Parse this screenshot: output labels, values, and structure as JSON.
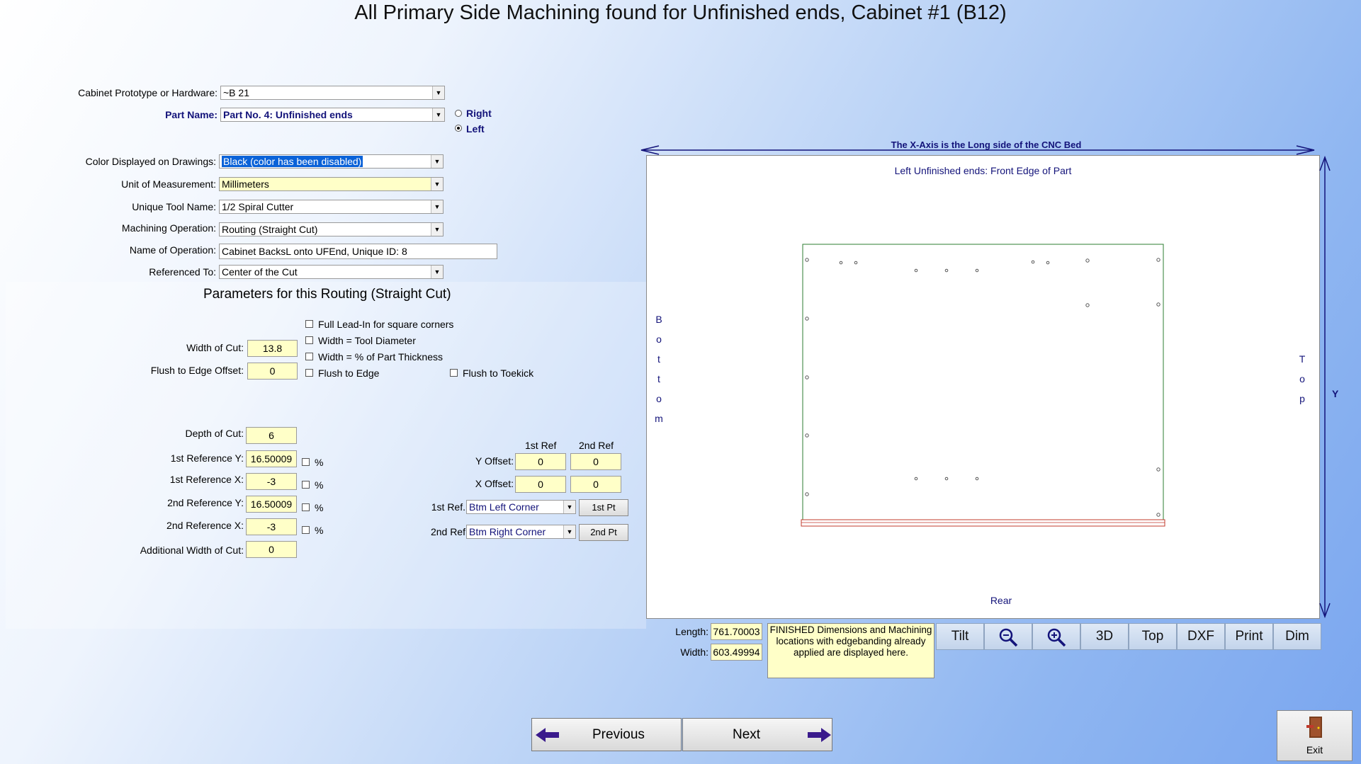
{
  "title": "All Primary Side Machining found for Unfinished ends, Cabinet #1 (B12)",
  "form": {
    "prototype": {
      "label": "Cabinet Prototype or Hardware:",
      "value": "~B 21"
    },
    "part_name": {
      "label": "Part Name:",
      "value": "Part No. 4:  Unfinished ends"
    },
    "side_right": "Right",
    "side_left": "Left",
    "color": {
      "label": "Color Displayed on Drawings:",
      "value": "Black (color has been disabled)"
    },
    "unit": {
      "label": "Unit of Measurement:",
      "value": "Millimeters"
    },
    "tool": {
      "label": "Unique Tool Name:",
      "value": "1/2 Spiral Cutter"
    },
    "operation": {
      "label": "Machining Operation:",
      "value": "Routing (Straight Cut)"
    },
    "op_name": {
      "label": "Name of Operation:",
      "value": "Cabinet BacksL onto UFEnd, Unique ID: 8"
    },
    "ref_to": {
      "label": "Referenced To:",
      "value": "Center of the Cut"
    }
  },
  "params": {
    "title": "Parameters for this Routing (Straight Cut)",
    "width_of_cut": {
      "label": "Width of Cut:",
      "value": "13.8"
    },
    "flush_offset": {
      "label": "Flush to Edge Offset:",
      "value": "0"
    },
    "chk_full_lead": "Full Lead-In for square corners",
    "chk_tool_dia": "Width = Tool Diameter",
    "chk_pct_thick": "Width = % of Part Thickness",
    "chk_flush_edge": "Flush to Edge",
    "chk_flush_toekick": "Flush to Toekick",
    "depth": {
      "label": "Depth of Cut:",
      "value": "6"
    },
    "ref1_y": {
      "label": "1st Reference Y:",
      "value": "16.50009"
    },
    "ref1_x": {
      "label": "1st Reference X:",
      "value": "-3"
    },
    "ref2_y": {
      "label": "2nd Reference Y:",
      "value": "16.50009"
    },
    "ref2_x": {
      "label": "2nd Reference X:",
      "value": "-3"
    },
    "add_width": {
      "label": "Additional Width of Cut:",
      "value": "0"
    },
    "pct": "%",
    "col_1st": "1st Ref",
    "col_2nd": "2nd Ref",
    "y_offset": {
      "label": "Y Offset:",
      "v1": "0",
      "v2": "0"
    },
    "x_offset": {
      "label": "X Offset:",
      "v1": "0",
      "v2": "0"
    },
    "ref1": {
      "label": "1st Ref.",
      "value": "Btm Left Corner",
      "button": "1st Pt"
    },
    "ref2": {
      "label": "2nd Ref",
      "value": "Btm Right Corner",
      "button": "2nd Pt"
    }
  },
  "drawing": {
    "x_axis_caption": "The X-Axis is the Long side of the CNC Bed",
    "subtitle": "Left Unfinished ends: Front Edge of Part",
    "left_label": [
      "B",
      "o",
      "t",
      "t",
      "o",
      "m"
    ],
    "right_label": [
      "T",
      "o",
      "p"
    ],
    "y_label": "Y",
    "bottom_label": "Rear",
    "length": {
      "label": "Length:",
      "value": "761.70003"
    },
    "width": {
      "label": "Width:",
      "value": "603.49994"
    },
    "info": "FINISHED Dimensions and Machining locations with edgebanding already applied are displayed here."
  },
  "toolbar": [
    "Tilt",
    "zoom-out",
    "zoom-in",
    "3D",
    "Top",
    "DXF",
    "Print",
    "Dim"
  ],
  "nav": {
    "previous": "Previous",
    "next": "Next",
    "exit": "Exit"
  },
  "colors": {
    "accent": "#13137a",
    "field_yellow": "#ffffc8",
    "part_outline": "#2e7d32",
    "cut_outline": "#c0392b"
  }
}
